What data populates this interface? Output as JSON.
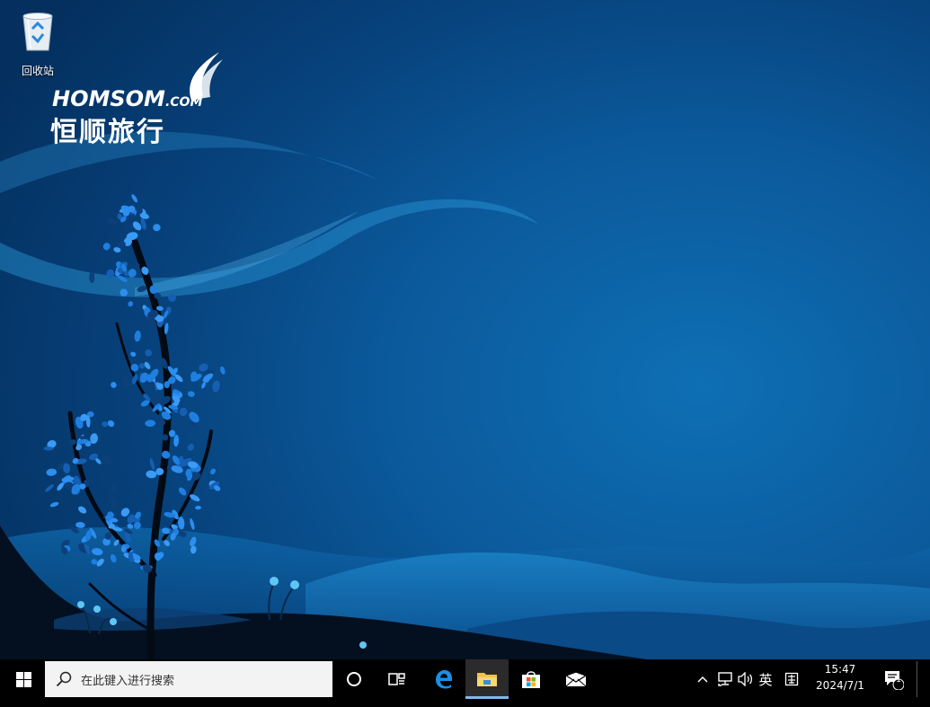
{
  "desktop": {
    "icons": [
      {
        "label": "回收站",
        "icon": "recycle-bin-icon"
      }
    ],
    "wallpaper": {
      "logo_brand": "HOMSOM",
      "logo_dotcom": ".COM",
      "logo_cn": "恒顺旅行"
    }
  },
  "taskbar": {
    "start_icon": "windows-logo-icon",
    "search_placeholder": "在此键入进行搜索",
    "pinned": [
      {
        "name": "cortana",
        "icon": "cortana-circle-icon"
      },
      {
        "name": "task-view",
        "icon": "task-view-icon"
      },
      {
        "name": "edge",
        "icon": "edge-icon"
      },
      {
        "name": "file-explorer",
        "icon": "folder-icon",
        "active": true
      },
      {
        "name": "store",
        "icon": "store-bag-icon"
      },
      {
        "name": "mail",
        "icon": "mail-icon"
      }
    ],
    "tray": {
      "ime_label": "英",
      "time": "15:47",
      "date": "2024/7/1",
      "notification_count": "1"
    }
  },
  "colors": {
    "taskbar": "#000000",
    "search_bg": "#f3f3f3",
    "accent": "#0b5a9c"
  }
}
